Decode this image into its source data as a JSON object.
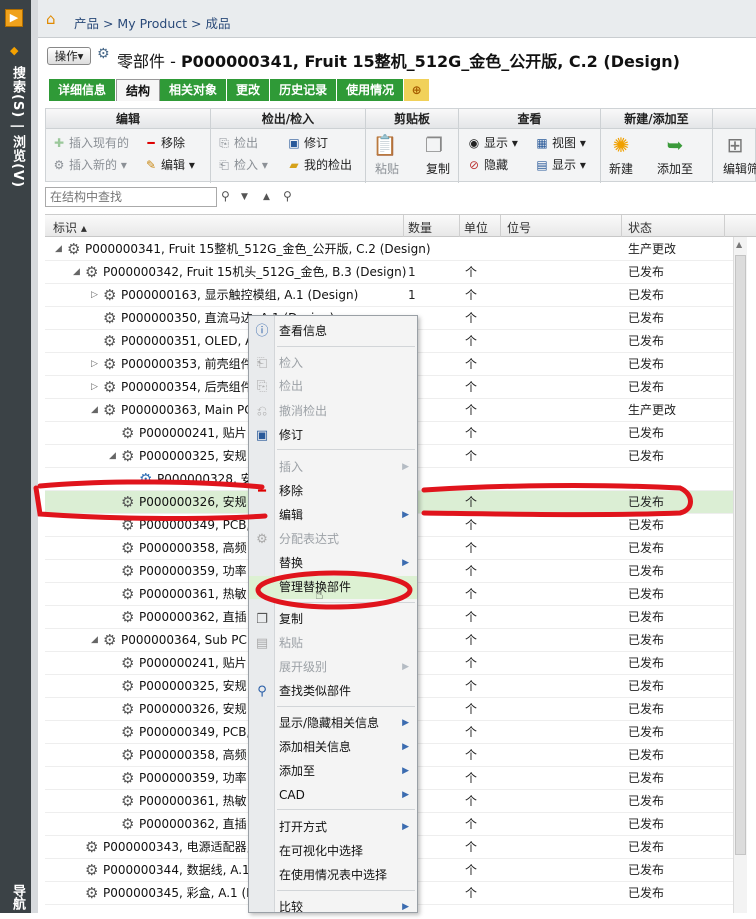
{
  "left_rail": {
    "search_label": "搜索(S)",
    "browse_label": "浏览(V)",
    "sep": " | ",
    "bottom_label": "导航"
  },
  "breadcrumb": "产品 > My Product > 成品",
  "title": {
    "action_label": "操作▾",
    "prefix": "零部件 - ",
    "main": "P000000341, Fruit 15整机_512G_金色_公开版, C.2 (Design)"
  },
  "tabs": [
    {
      "label": "详细信息",
      "active": false
    },
    {
      "label": "结构",
      "active": true
    },
    {
      "label": "相关对象",
      "active": false
    },
    {
      "label": "更改",
      "active": false
    },
    {
      "label": "历史记录",
      "active": false
    },
    {
      "label": "使用情况",
      "active": false
    }
  ],
  "toolbar": {
    "groups": {
      "edit": "编辑",
      "checkout": "检出/检入",
      "clipboard": "剪贴板",
      "view": "查看",
      "new_add": "新建/添加至"
    },
    "insert_existing": "插入现有的",
    "insert_new": "插入新的",
    "remove": "移除",
    "edit": "编辑",
    "check_out": "检出",
    "check_in": "检入",
    "revise": "修订",
    "my_checkouts": "我的检出",
    "paste": "粘贴",
    "copy": "复制",
    "show": "显示",
    "hide": "隐藏",
    "view": "视图",
    "display": "显示",
    "new": "新建",
    "add_to": "添加至",
    "edit_filter": "编辑筛"
  },
  "search": {
    "placeholder": "在结构中查找"
  },
  "columns": {
    "id": "标识 ▴",
    "qty": "数量",
    "unit": "单位",
    "position": "位号",
    "status": "状态"
  },
  "rows": [
    {
      "name": "P000000341, Fruit 15整机_512G_金色_公开版, C.2 (Design)",
      "qty": "",
      "unit": "",
      "status": "生产更改"
    },
    {
      "name": "P000000342, Fruit 15机头_512G_金色, B.3 (Design)",
      "qty": "1",
      "unit": "个",
      "status": "已发布"
    },
    {
      "name": "P000000163, 显示触控模组, A.1 (Design)",
      "qty": "1",
      "unit": "个",
      "status": "已发布"
    },
    {
      "name": "P000000350, 直流马达, A.1 (Design)",
      "qty": "",
      "unit": "个",
      "status": "已发布"
    },
    {
      "name": "P000000351, OLED, A.",
      "qty": "",
      "unit": "个",
      "status": "已发布"
    },
    {
      "name": "P000000353, 前壳组件,",
      "qty": "",
      "unit": "个",
      "status": "已发布"
    },
    {
      "name": "P000000354, 后壳组件,",
      "qty": "",
      "unit": "个",
      "status": "已发布"
    },
    {
      "name": "P000000363, Main PCB",
      "qty": "",
      "unit": "个",
      "status": "生产更改"
    },
    {
      "name": "P000000241, 贴片电",
      "qty": "",
      "unit": "个",
      "status": "已发布"
    },
    {
      "name": "P000000325, 安规电",
      "qty": "",
      "unit": "个",
      "status": "已发布"
    },
    {
      "name": "P000000328, 安规",
      "qty": "",
      "unit": "",
      "status": ""
    },
    {
      "name": "P000000326, 安规电",
      "qty": "",
      "unit": "个",
      "status": "已发布"
    },
    {
      "name": "P000000349, PCB, A",
      "qty": "",
      "unit": "个",
      "status": "已发布"
    },
    {
      "name": "P000000358, 高频电",
      "qty": "",
      "unit": "个",
      "status": "已发布"
    },
    {
      "name": "P000000359, 功率电",
      "qty": "",
      "unit": "个",
      "status": "已发布"
    },
    {
      "name": "P000000361, 热敏电",
      "qty": "",
      "unit": "个",
      "status": "已发布"
    },
    {
      "name": "P000000362, 直插电",
      "qty": "",
      "unit": "个",
      "status": "已发布"
    },
    {
      "name": "P000000364, Sub PCBA",
      "qty": "",
      "unit": "个",
      "status": "已发布"
    },
    {
      "name": "P000000241, 贴片电",
      "qty": "",
      "unit": "个",
      "status": "已发布"
    },
    {
      "name": "P000000325, 安规电",
      "qty": "",
      "unit": "个",
      "status": "已发布"
    },
    {
      "name": "P000000326, 安规电",
      "qty": "",
      "unit": "个",
      "status": "已发布"
    },
    {
      "name": "P000000349, PCB, A",
      "qty": "",
      "unit": "个",
      "status": "已发布"
    },
    {
      "name": "P000000358, 高频电",
      "qty": "",
      "unit": "个",
      "status": "已发布"
    },
    {
      "name": "P000000359, 功率电",
      "qty": "",
      "unit": "个",
      "status": "已发布"
    },
    {
      "name": "P000000361, 热敏电",
      "qty": "",
      "unit": "个",
      "status": "已发布"
    },
    {
      "name": "P000000362, 直插电",
      "qty": "",
      "unit": "个",
      "status": "已发布"
    },
    {
      "name": "P000000343, 电源适配器, A",
      "qty": "",
      "unit": "个",
      "status": "已发布"
    },
    {
      "name": "P000000344, 数据线, A.1 (",
      "qty": "",
      "unit": "个",
      "status": "已发布"
    },
    {
      "name": "P000000345, 彩盒, A.1 (De",
      "qty": "",
      "unit": "个",
      "status": "已发布"
    }
  ],
  "context_menu": [
    {
      "label": "查看信息",
      "enabled": true,
      "submenu": false,
      "icon": "info-icon"
    },
    {
      "label": "检入",
      "enabled": false,
      "submenu": false,
      "icon": "check-in-icon"
    },
    {
      "label": "检出",
      "enabled": false,
      "submenu": false,
      "icon": "check-out-icon"
    },
    {
      "label": "撤消检出",
      "enabled": false,
      "submenu": false,
      "icon": "undo-checkout-icon"
    },
    {
      "label": "修订",
      "enabled": true,
      "submenu": false,
      "icon": "revise-icon"
    },
    {
      "label": "插入",
      "enabled": false,
      "submenu": true,
      "icon": ""
    },
    {
      "label": "移除",
      "enabled": true,
      "submenu": false,
      "icon": "remove-icon"
    },
    {
      "label": "编辑",
      "enabled": true,
      "submenu": true,
      "icon": ""
    },
    {
      "label": "分配表达式",
      "enabled": false,
      "submenu": false,
      "icon": "assign-expression-icon"
    },
    {
      "label": "替换",
      "enabled": true,
      "submenu": true,
      "icon": ""
    },
    {
      "label": "管理替换部件",
      "enabled": true,
      "submenu": false,
      "icon": "",
      "highlighted": true
    },
    {
      "label": "复制",
      "enabled": true,
      "submenu": false,
      "icon": "copy-icon"
    },
    {
      "label": "粘贴",
      "enabled": false,
      "submenu": false,
      "icon": "paste-icon"
    },
    {
      "label": "展开级别",
      "enabled": false,
      "submenu": true,
      "icon": ""
    },
    {
      "label": "查找类似部件",
      "enabled": true,
      "submenu": false,
      "icon": "find-similar-icon"
    },
    {
      "label": "显示/隐藏相关信息",
      "enabled": true,
      "submenu": true,
      "icon": ""
    },
    {
      "label": "添加相关信息",
      "enabled": true,
      "submenu": true,
      "icon": ""
    },
    {
      "label": "添加至",
      "enabled": true,
      "submenu": true,
      "icon": ""
    },
    {
      "label": "CAD",
      "enabled": true,
      "submenu": true,
      "icon": ""
    },
    {
      "label": "打开方式",
      "enabled": true,
      "submenu": true,
      "icon": ""
    },
    {
      "label": "在可视化中选择",
      "enabled": true,
      "submenu": false,
      "icon": ""
    },
    {
      "label": "在使用情况表中选择",
      "enabled": true,
      "submenu": false,
      "icon": ""
    },
    {
      "label": "比较",
      "enabled": true,
      "submenu": true,
      "icon": ""
    }
  ],
  "colors": {
    "tab_green": "#2f9a37",
    "annotation_red": "#e0141c",
    "selected_row": "#dbeed4",
    "menu_highlight": "#ddf1d3"
  }
}
